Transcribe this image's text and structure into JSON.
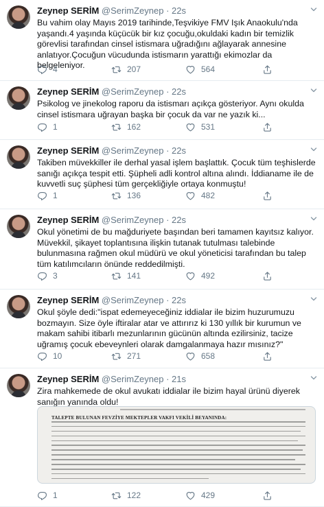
{
  "author": {
    "name": "Zeynep SERİM",
    "handle": "@SerimZeynep",
    "separator": "·"
  },
  "tweets": [
    {
      "time": "22s",
      "text": "Bu vahim olay Mayıs 2019 tarihinde,Teşvikiye FMV Işık Anaokulu'nda yaşandı.4 yaşında küçücük bir kız çocuğu,okuldaki kadın bir temizlik görevlisi tarafından cinsel istismara uğradığını ağlayarak annesine anlatıyor.Çocuğun vücudunda istismarın yarattığı ekimozlar da belgeleniyor.",
      "replies": "4",
      "retweets": "207",
      "likes": "564"
    },
    {
      "time": "22s",
      "text": "Psikolog ve jinekolog raporu da istismarı açıkça gösteriyor. Aynı okulda cinsel istismara uğrayan başka bir çocuk da var ne yazık ki...",
      "replies": "1",
      "retweets": "162",
      "likes": "531"
    },
    {
      "time": "22s",
      "text": "Takiben müvekkiller ile derhal yasal işlem başlattık. Çocuk tüm teşhislerde sanığı açıkça tespit etti. Şüpheli adli kontrol altına alındı. İddianame ile de kuvvetli suç şüphesi tüm gerçekliğiyle ortaya konmuştu!",
      "replies": "1",
      "retweets": "136",
      "likes": "482"
    },
    {
      "time": "22s",
      "text": "Okul yönetimi de bu mağduriyete başından beri tamamen kayıtsız kalıyor. Müvekkil, şikayet toplantısına ilişkin tutanak tutulması talebinde bulunmasına rağmen okul müdürü ve okul yöneticisi tarafından bu talep tüm katılımcıların önünde reddedilmişti.",
      "replies": "3",
      "retweets": "141",
      "likes": "492"
    },
    {
      "time": "22s",
      "text": "Okul şöyle dedi:\"ispat edemeyeceğiniz iddialar ile bizim huzurumuzu bozmayın. Size öyle iftiralar atar ve attırırız ki 130 yıllık bir kurumun ve makam sahibi itibarlı mezunlarının gücünün altında ezilirsiniz, tacize uğramış çocuk ebeveynleri olarak damgalanmaya hazır mısınız?\"",
      "replies": "10",
      "retweets": "271",
      "likes": "658"
    },
    {
      "time": "21s",
      "text": "Zira mahkemede de okul avukatı iddialar ile bizim hayal ürünü diyerek sanığın yanında oldu!",
      "media_caption": "TALEPTE BULUNAN FEVZİYE MEKTEPLER VAKFI VEKİLİ BEYANINDA:",
      "replies": "1",
      "retweets": "122",
      "likes": "429"
    }
  ],
  "icons": {
    "reply": "reply-icon",
    "retweet": "retweet-icon",
    "like": "like-icon",
    "share": "share-icon",
    "more": "chevron-down-icon"
  },
  "colors": {
    "text": "#14171a",
    "muted": "#657786",
    "divider": "#e6ecf0"
  }
}
